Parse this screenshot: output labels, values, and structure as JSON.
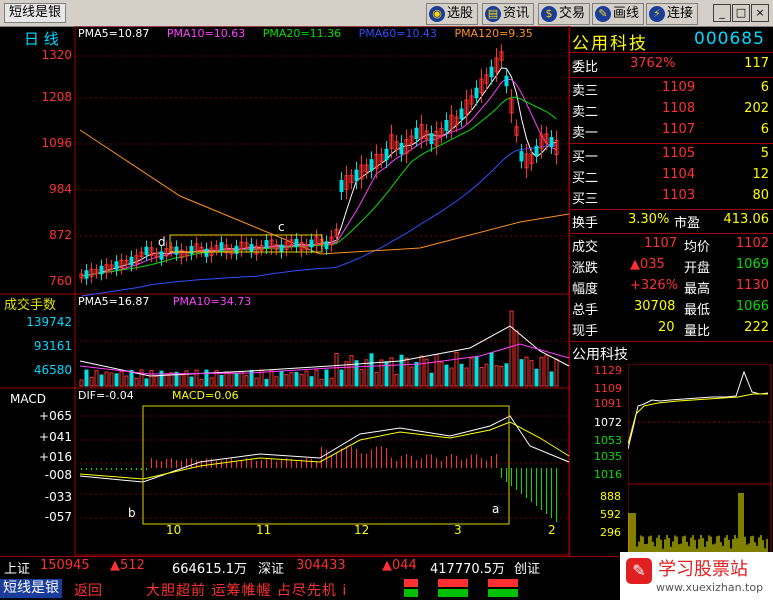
{
  "titlebar": {
    "app_name": "短线是银",
    "buttons": [
      {
        "label": "选股",
        "icon": "globe-icon"
      },
      {
        "label": "资讯",
        "icon": "news-icon"
      },
      {
        "label": "交易",
        "icon": "trade-icon"
      },
      {
        "label": "画线",
        "icon": "draw-icon"
      },
      {
        "label": "连接",
        "icon": "connect-icon"
      }
    ],
    "window_buttons": [
      "_",
      "□",
      "×"
    ]
  },
  "kline": {
    "period": "日 线",
    "ma_legend": [
      {
        "label": "PMA5=10.87",
        "color": "#ffffff"
      },
      {
        "label": "PMA10=10.63",
        "color": "#ff40ff"
      },
      {
        "label": "PMA20=11.36",
        "color": "#00e000"
      },
      {
        "label": "PMA60=10.43",
        "color": "#3050ff"
      },
      {
        "label": "PMA120=9.35",
        "color": "#ff9020"
      }
    ],
    "y_ticks": [
      "1320",
      "1208",
      "1096",
      "984",
      "872",
      "760"
    ],
    "annotations": {
      "c": "c",
      "d": "d"
    }
  },
  "volume": {
    "title": "成交手数",
    "legend": [
      {
        "label": "PMA5=16.87",
        "color": "#ffffff"
      },
      {
        "label": "PMA10=34.73",
        "color": "#ff40ff"
      }
    ],
    "y_ticks": [
      "139742",
      "93161",
      "46580"
    ]
  },
  "macd": {
    "title": "MACD",
    "dif": "DIF=-0.04",
    "macd_val": "MACD=0.06",
    "y_ticks": [
      "+065",
      "+041",
      "+016",
      "-008",
      "-033",
      "-057"
    ],
    "annotations": {
      "a": "a",
      "b": "b"
    },
    "x_ticks": [
      "10",
      "11",
      "12",
      "3",
      "2"
    ]
  },
  "quote": {
    "name": "公用科技",
    "code": "000685",
    "weibi_label": "委比",
    "weibi_value": "3762%",
    "weibi_diff": "117",
    "asks": [
      {
        "label": "卖三",
        "price": "1109",
        "vol": "6"
      },
      {
        "label": "卖二",
        "price": "1108",
        "vol": "202"
      },
      {
        "label": "卖一",
        "price": "1107",
        "vol": "6"
      }
    ],
    "bids": [
      {
        "label": "买一",
        "price": "1105",
        "vol": "5"
      },
      {
        "label": "买二",
        "price": "1104",
        "vol": "12"
      },
      {
        "label": "买三",
        "price": "1103",
        "vol": "80"
      }
    ],
    "stats": [
      {
        "l1": "换手",
        "v1": "3.30%",
        "l2": "市盈",
        "v2": "413.06"
      },
      {
        "l1": "成交",
        "v1": "1107",
        "l2": "均价",
        "v2": "1102"
      },
      {
        "l1": "涨跌",
        "v1": "▲035",
        "l2": "开盘",
        "v2": "1069"
      },
      {
        "l1": "幅度",
        "v1": "+326%",
        "l2": "最高",
        "v2": "1130"
      },
      {
        "l1": "总手",
        "v1": "30708",
        "l2": "最低",
        "v2": "1066"
      },
      {
        "l1": "现手",
        "v1": "20",
        "l2": "量比",
        "v2": "222"
      }
    ]
  },
  "mini": {
    "name": "公用科技",
    "price_ticks": [
      "1129",
      "1109",
      "1091",
      "1072",
      "1053",
      "1035",
      "1016"
    ],
    "vol_ticks": [
      "888",
      "592",
      "296"
    ]
  },
  "statusbar": {
    "sh_label": "上证",
    "sh_value": "150945",
    "sh_change": "▲512",
    "sh_amount": "664615.1万",
    "sz_label": "深证",
    "sz_value": "304433",
    "sz_change": "▲044",
    "sz_amount": "417770.5万",
    "cy_label": "创证"
  },
  "ticker": {
    "app_tag": "短线是银",
    "back": "返回",
    "text": "大胆超前  运筹帷幄  占尽先机  ⅰ"
  },
  "watermark": {
    "title": "学习股票站",
    "url": "www.xuexizhan.top"
  }
}
